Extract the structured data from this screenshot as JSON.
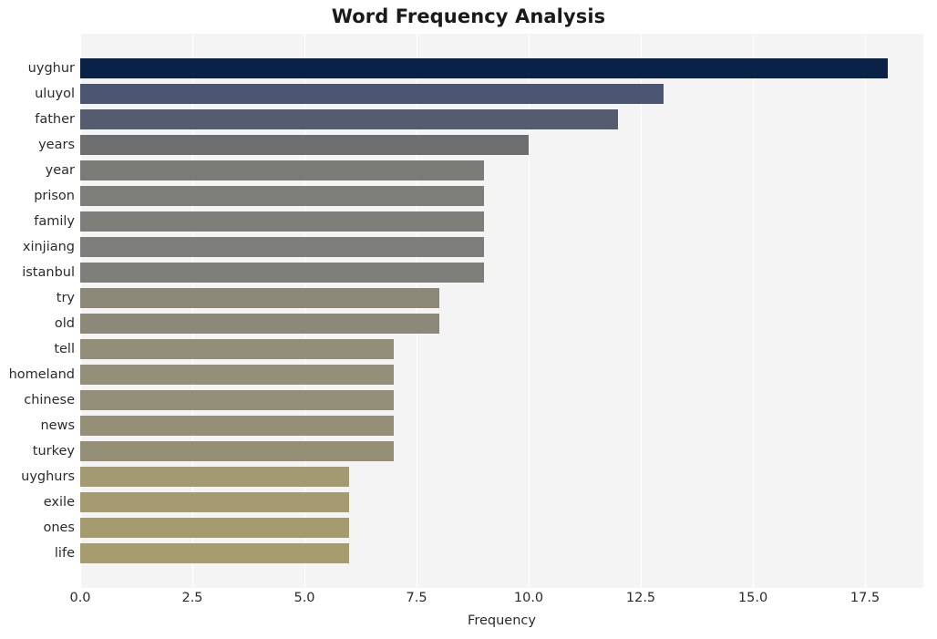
{
  "chart_data": {
    "type": "bar",
    "orientation": "horizontal",
    "title": "Word Frequency Analysis",
    "xlabel": "Frequency",
    "ylabel": "",
    "categories": [
      "uyghur",
      "uluyol",
      "father",
      "years",
      "year",
      "prison",
      "family",
      "xinjiang",
      "istanbul",
      "try",
      "old",
      "tell",
      "homeland",
      "chinese",
      "news",
      "turkey",
      "uyghurs",
      "exile",
      "ones",
      "life"
    ],
    "values": [
      18,
      13,
      12,
      10,
      9,
      9,
      9,
      9,
      9,
      8,
      8,
      7,
      7,
      7,
      7,
      7,
      6,
      6,
      6,
      6
    ],
    "bar_colors": [
      "#0a2248",
      "#4a5572",
      "#565c70",
      "#6d6e70",
      "#7b7b77",
      "#7d7d79",
      "#7d7d79",
      "#7d7d79",
      "#7d7d79",
      "#8b8877",
      "#8b8878",
      "#928e78",
      "#948f78",
      "#948f78",
      "#958f78",
      "#958f78",
      "#a39a71",
      "#a49b71",
      "#a49b70",
      "#a59c70"
    ],
    "xticks": [
      "0.0",
      "2.5",
      "5.0",
      "7.5",
      "10.0",
      "12.5",
      "15.0",
      "17.5"
    ],
    "xtick_values": [
      0.0,
      2.5,
      5.0,
      7.5,
      10.0,
      12.5,
      15.0,
      17.5
    ],
    "xlim": [
      0,
      18.8
    ],
    "grid": "vertical-white",
    "legend": "none",
    "plot_background": "#f4f4f5",
    "figure_background": "#ffffff",
    "title_color": "#1a1a1a",
    "tick_color": "#2b2b2b"
  }
}
